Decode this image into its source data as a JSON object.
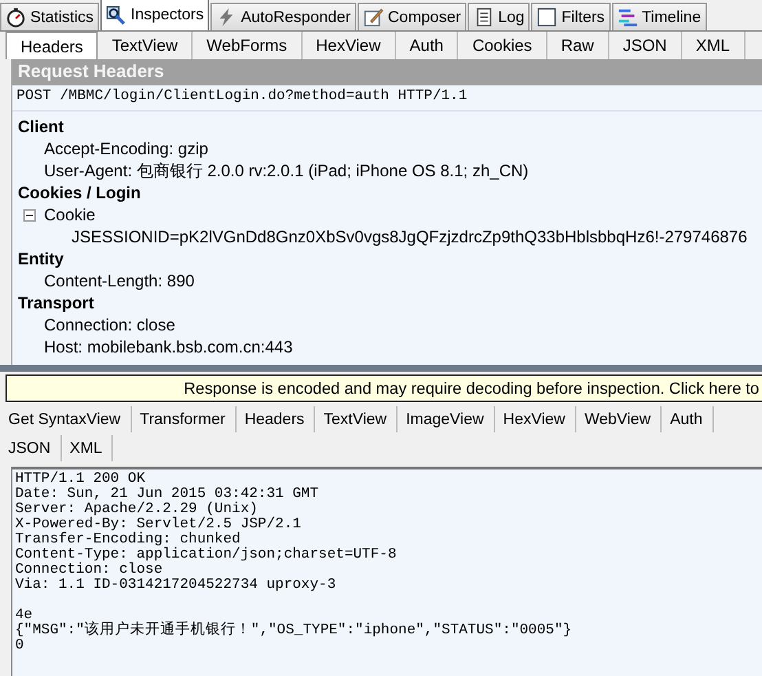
{
  "main_tabs": [
    {
      "label": "Statistics",
      "selected": false
    },
    {
      "label": "Inspectors",
      "selected": true
    },
    {
      "label": "AutoResponder",
      "selected": false
    },
    {
      "label": "Composer",
      "selected": false
    },
    {
      "label": "Log",
      "selected": false
    },
    {
      "label": "Filters",
      "selected": false
    },
    {
      "label": "Timeline",
      "selected": false
    }
  ],
  "request_tabs": [
    {
      "label": "Headers",
      "selected": true
    },
    {
      "label": "TextView",
      "selected": false
    },
    {
      "label": "WebForms",
      "selected": false
    },
    {
      "label": "HexView",
      "selected": false
    },
    {
      "label": "Auth",
      "selected": false
    },
    {
      "label": "Cookies",
      "selected": false
    },
    {
      "label": "Raw",
      "selected": false
    },
    {
      "label": "JSON",
      "selected": false
    },
    {
      "label": "XML",
      "selected": false
    }
  ],
  "request_headers": {
    "title": "Request Headers",
    "request_line": "POST /MBMC/login/ClientLogin.do?method=auth HTTP/1.1",
    "groups": [
      {
        "title": "Client",
        "children": [
          {
            "text": "Accept-Encoding: gzip"
          },
          {
            "text": "User-Agent: 包商银行 2.0.0 rv:2.0.1 (iPad; iPhone OS 8.1; zh_CN)"
          }
        ]
      },
      {
        "title": "Cookies / Login",
        "children": [
          {
            "text": "Cookie",
            "expanded": true,
            "children": [
              {
                "text": "JSESSIONID=pK2lVGnDd8Gnz0XbSv0vgs8JgQFzjzdrcZp9thQ33bHblsbbqHz6!-279746876"
              }
            ]
          }
        ]
      },
      {
        "title": "Entity",
        "children": [
          {
            "text": "Content-Length: 890"
          }
        ]
      },
      {
        "title": "Transport",
        "children": [
          {
            "text": "Connection: close"
          },
          {
            "text": "Host: mobilebank.bsb.com.cn:443"
          }
        ]
      }
    ]
  },
  "notice": "Response is encoded and may require decoding before inspection. Click here to",
  "response_tabs": [
    [
      {
        "label": "Get SyntaxView",
        "selected": false
      },
      {
        "label": "Transformer",
        "selected": false
      },
      {
        "label": "Headers",
        "selected": false
      },
      {
        "label": "TextView",
        "selected": false
      },
      {
        "label": "ImageView",
        "selected": false
      },
      {
        "label": "HexView",
        "selected": false
      },
      {
        "label": "WebView",
        "selected": false
      },
      {
        "label": "Auth",
        "selected": false
      }
    ],
    [
      {
        "label": "JSON",
        "selected": false
      },
      {
        "label": "XML",
        "selected": false
      }
    ]
  ],
  "response_lines": [
    "HTTP/1.1 200 OK",
    "Date: Sun, 21 Jun 2015 03:42:31 GMT",
    "Server: Apache/2.2.29 (Unix)",
    "X-Powered-By: Servlet/2.5 JSP/2.1",
    "Transfer-Encoding: chunked",
    "Content-Type: application/json;charset=UTF-8",
    "Connection: close",
    "Via: 1.1 ID-0314217204522734 uproxy-3"
  ],
  "response_body": [
    "4e",
    "{\"MSG\":\"该用户未开通手机银行！\",\"OS_TYPE\":\"iphone\",\"STATUS\":\"0005\"}",
    "0"
  ]
}
